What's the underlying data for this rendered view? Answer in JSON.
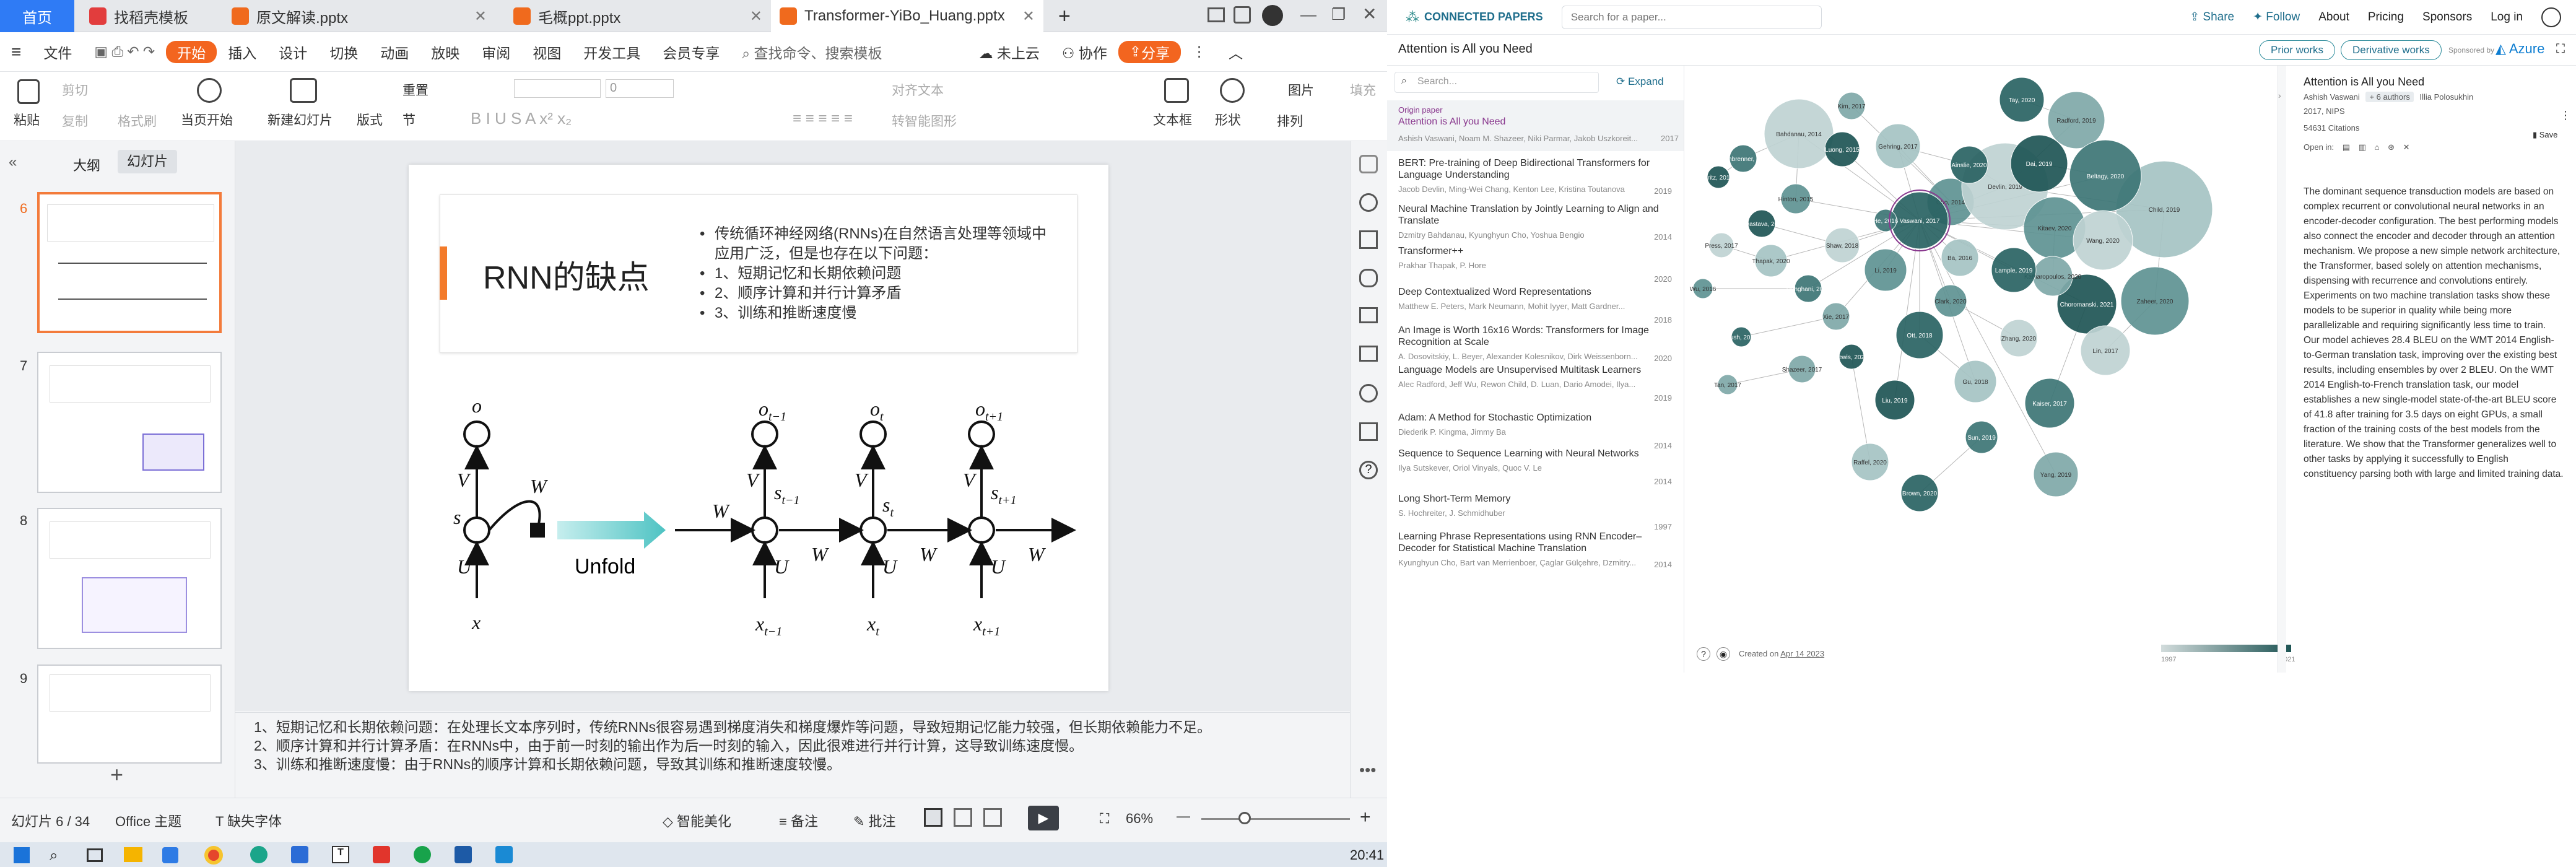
{
  "wps": {
    "tabs": {
      "home": "首页",
      "t1": "找稻壳模板",
      "t2": "原文解读.pptx",
      "t3": "毛概ppt.pptx",
      "t4": "Transformer-YiBo_Huang.pptx"
    },
    "menu": {
      "file": "文件",
      "start": "开始",
      "insert": "插入",
      "design": "设计",
      "switch": "切换",
      "anim": "动画",
      "show": "放映",
      "review": "审阅",
      "view": "视图",
      "dev": "开发工具",
      "vip": "会员专享",
      "search": "查找命令、搜索模板",
      "cloud": "未上云",
      "collab": "协作",
      "share": "分享"
    },
    "ribbon": {
      "paste": "粘贴",
      "cut": "剪切",
      "copy": "复制",
      "format": "格式刷",
      "play": "当页开始",
      "newslide": "新建幻灯片",
      "layout": "版式",
      "section": "节",
      "reset": "重置",
      "textbox": "文本框",
      "shape": "形状",
      "arrange": "排列",
      "picture": "图片",
      "fill": "填充",
      "align_text": "对齐文本",
      "convert": "转智能图形",
      "font_size": "0"
    },
    "panel": {
      "outline": "大纲",
      "slides": "幻灯片",
      "nums": [
        "6",
        "7",
        "8",
        "9"
      ]
    },
    "slide": {
      "title": "RNN的缺点",
      "bullet_intro": "传统循环神经网络(RNNs)在自然语言处理等领域中应用广泛，但是也存在以下问题：",
      "b1": "1、短期记忆和长期依赖问题",
      "b2": "2、顺序计算和并行计算矛盾",
      "b3": "3、训练和推断速度慢",
      "unfold": "Unfold"
    },
    "notes": [
      "1、短期记忆和长期依赖问题：在处理长文本序列时，传统RNNs很容易遇到梯度消失和梯度爆炸等问题，导致短期记忆能力较强，但长期依赖能力不足。",
      "2、顺序计算和并行计算矛盾：在RNNs中，由于前一时刻的输出作为后一时刻的输入，因此很难进行并行计算，这导致训练速度慢。",
      "3、训练和推断速度慢：由于RNNs的顺序计算和长期依赖问题，导致其训练和推断速度较慢。"
    ],
    "status": {
      "slide_count": "幻灯片 6 / 34",
      "theme": "Office 主题",
      "missing_font": "缺失字体",
      "beautify": "智能美化",
      "notes_btn": "备注",
      "comment": "批注",
      "zoom": "66%"
    },
    "clock": "20:41"
  },
  "cp": {
    "brand": "CONNECTED PAPERS",
    "search_placeholder": "Search for a paper...",
    "nav": {
      "share": "Share",
      "follow": "Follow",
      "about": "About",
      "pricing": "Pricing",
      "sponsors": "Sponsors",
      "login": "Log in"
    },
    "graph_title": "Attention is All you Need",
    "prior": "Prior works",
    "derivative": "Derivative works",
    "sponsored": "Sponsored by",
    "azure": "Azure",
    "list_search_placeholder": "Search...",
    "expand": "Expand",
    "origin_label": "Origin paper",
    "origin": {
      "title": "Attention is All you Need",
      "authors": "Ashish Vaswani, Noam M. Shazeer, Niki Parmar, Jakob Uszkoreit...",
      "year": "2017"
    },
    "papers": [
      {
        "title": "BERT: Pre-training of Deep Bidirectional Transformers for Language Understanding",
        "authors": "Jacob Devlin, Ming-Wei Chang, Kenton Lee, Kristina Toutanova",
        "year": "2019"
      },
      {
        "title": "Neural Machine Translation by Jointly Learning to Align and Translate",
        "authors": "Dzmitry Bahdanau, Kyunghyun Cho, Yoshua Bengio",
        "year": "2014"
      },
      {
        "title": "Transformer++",
        "authors": "Prakhar Thapak, P. Hore",
        "year": "2020"
      },
      {
        "title": "Deep Contextualized Word Representations",
        "authors": "Matthew E. Peters, Mark Neumann, Mohit Iyyer, Matt Gardner...",
        "year": "2018"
      },
      {
        "title": "An Image is Worth 16x16 Words: Transformers for Image Recognition at Scale",
        "authors": "A. Dosovitskiy, L. Beyer, Alexander Kolesnikov, Dirk Weissenborn...",
        "year": "2020"
      },
      {
        "title": "Language Models are Unsupervised Multitask Learners",
        "authors": "Alec Radford, Jeff Wu, Rewon Child, D. Luan, Dario Amodei, Ilya...",
        "year": "2019"
      },
      {
        "title": "Adam: A Method for Stochastic Optimization",
        "authors": "Diederik P. Kingma, Jimmy Ba",
        "year": "2014"
      },
      {
        "title": "Sequence to Sequence Learning with Neural Networks",
        "authors": "Ilya Sutskever, Oriol Vinyals, Quoc V. Le",
        "year": "2014"
      },
      {
        "title": "Long Short-Term Memory",
        "authors": "S. Hochreiter, J. Schmidhuber",
        "year": "1997"
      },
      {
        "title": "Learning Phrase Representations using RNN Encoder–Decoder for Statistical Machine Translation",
        "authors": "Kyunghyun Cho, Bart van Merrienboer, Çaglar Gülçehre, Dzmitry...",
        "year": "2014"
      }
    ],
    "created": "Created on",
    "created_date": "Apr 14 2023",
    "legend": {
      "min": "1997",
      "max": "2021"
    },
    "detail": {
      "title": "Attention is All you Need",
      "author1": "Ashish Vaswani",
      "more_authors": "+ 6 authors",
      "author2": "Illia Polosukhin",
      "venue": "2017, NIPS",
      "citations": "54631 Citations",
      "open_in": "Open in:",
      "save": "Save",
      "abstract": "The dominant sequence transduction models are based on complex recurrent or convolutional neural networks in an encoder-decoder configuration. The best performing models also connect the encoder and decoder through an attention mechanism. We propose a new simple network architecture, the Transformer, based solely on attention mechanisms, dispensing with recurrence and convolutions entirely. Experiments on two machine translation tasks show these models to be superior in quality while being more parallelizable and requiring significantly less time to train. Our model achieves 28.4 BLEU on the WMT 2014 English-to-German translation task, improving over the existing best results, including ensembles by over 2 BLEU. On the WMT 2014 English-to-French translation task, our model establishes a new single-model state-of-the-art BLEU score of 41.8 after training for 3.5 days on eight GPUs, a small fraction of the training costs of the best models from the literature. We show that the Transformer generalizes well to other tasks by applying it successfully to English constituency parsing both with large and limited training data."
    },
    "node_labels": [
      "Bahdanau, 2014",
      "Cho, 2014",
      "Luong, 2015",
      "Kim, 2017",
      "Vaswani, 2017",
      "Gehring, 2017",
      "Kalchbrenner, 2016",
      "Devlin, 2019",
      "Kitaev, 2020",
      "Dai, 2019",
      "Radford, 2019",
      "Tay, 2020",
      "Child, 2019",
      "Beltagy, 2020",
      "Wang, 2020",
      "Zaheer, 2020",
      "Choromanski, 2021",
      "Katharopoulos, 2020",
      "Lample, 2019",
      "Ba, 2016",
      "He, 2016",
      "Shaw, 2018",
      "Hinton, 2015",
      "Srivastava, 2014",
      "Xie, 2017",
      "Rush, 2015",
      "Thapak, 2020",
      "Dehghani, 2018",
      "Press, 2017",
      "Wu, 2016",
      "Britz, 2017",
      "Tan, 2017",
      "Ott, 2018",
      "Gu, 2018",
      "Kaiser, 2017",
      "Lin, 2017",
      "Li, 2019",
      "Liu, 2019",
      "Yang, 2019",
      "Brown, 2020",
      "Raffel, 2020",
      "Sun, 2019",
      "Zhang, 2020",
      "Clark, 2020",
      "Lewis, 2020",
      "Shazeer, 2017",
      "Ainslie, 2020"
    ]
  }
}
